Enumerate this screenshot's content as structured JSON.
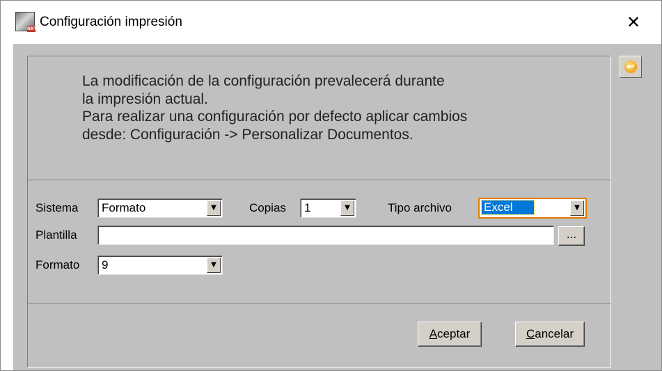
{
  "window": {
    "title": "Configuración impresión",
    "icon": "app-document-icon",
    "icon_badge": "NXT",
    "close_glyph": "✕"
  },
  "side_button": {
    "icon": "return-arrow-icon",
    "glyph": "↩"
  },
  "message": {
    "lines": [
      "La modificación de la configuración prevalecerá durante",
      "la impresión actual.",
      "Para realizar una configuración por defecto aplicar cambios",
      "desde: Configuración -> Personalizar Documentos."
    ]
  },
  "fields": {
    "sistema": {
      "label": "Sistema",
      "value": "Formato"
    },
    "copias": {
      "label": "Copias",
      "value": "1"
    },
    "tipo_archivo": {
      "label": "Tipo archivo",
      "value": "Excel"
    },
    "plantilla": {
      "label": "Plantilla",
      "value": "",
      "browse_label": "..."
    },
    "formato": {
      "label": "Formato",
      "value": "9"
    },
    "dropdown_glyph": "▼"
  },
  "buttons": {
    "accept": {
      "accel": "A",
      "rest": "ceptar"
    },
    "cancel": {
      "accel": "C",
      "rest": "ancelar"
    }
  },
  "colors": {
    "dialog_bg": "#c0c0c0",
    "selection": "#0078d7",
    "focus_border": "#e07a00"
  }
}
